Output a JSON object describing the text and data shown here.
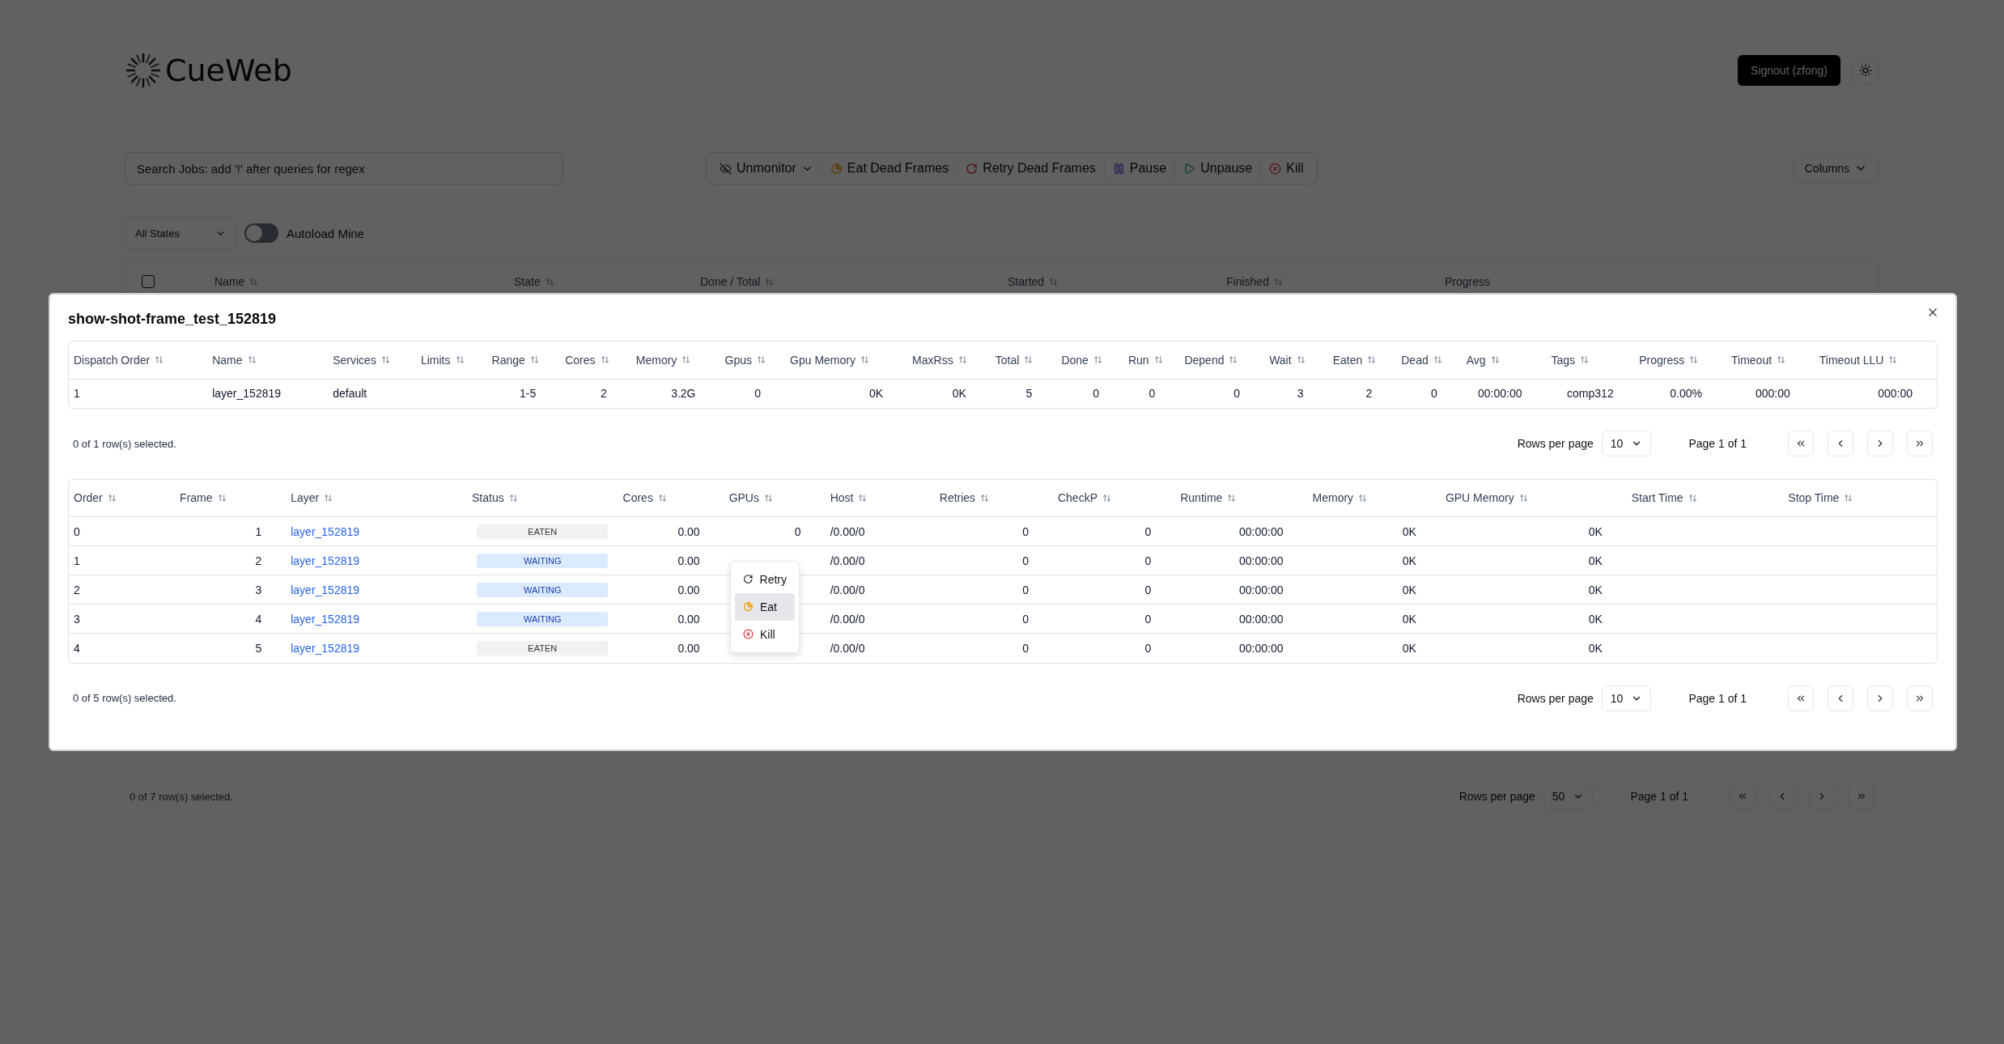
{
  "header": {
    "logo": "CueWeb",
    "signout": "Signout (zfong)"
  },
  "search": {
    "placeholder": "Search Jobs: add '!' after queries for regex"
  },
  "toolbar": [
    {
      "label": "Unmonitor",
      "kind": "unmonitor"
    },
    {
      "label": "Eat Dead Frames",
      "kind": "eat"
    },
    {
      "label": "Retry Dead Frames",
      "kind": "retry"
    },
    {
      "label": "Pause",
      "kind": "pause"
    },
    {
      "label": "Unpause",
      "kind": "unpause"
    },
    {
      "label": "Kill",
      "kind": "kill"
    }
  ],
  "columns_button": "Columns",
  "filters": {
    "state": "All States",
    "autoload": {
      "label": "Autoload Mine",
      "on": false
    }
  },
  "jobs_table": {
    "checked": false,
    "columns": [
      "Name",
      "State",
      "Done / Total",
      "Started",
      "Finished",
      "Progress"
    ]
  },
  "jobs_footer": {
    "selected_text": "0 of 7 row(s) selected.",
    "rows_per_page_label": "Rows per page",
    "rows_per_page": "50",
    "page": "Page 1 of 1"
  },
  "dialog": {
    "title": "show-shot-frame_test_152819",
    "layers_table": {
      "columns": [
        "Dispatch Order",
        "Name",
        "Services",
        "Limits",
        "Range",
        "Cores",
        "Memory",
        "Gpus",
        "Gpu Memory",
        "MaxRss",
        "Total",
        "Done",
        "Run",
        "Depend",
        "Wait",
        "Eaten",
        "Dead",
        "Avg",
        "Tags",
        "Progress",
        "Timeout",
        "Timeout LLU"
      ],
      "rows": [
        [
          "1",
          "layer_152819",
          "default",
          null,
          "1-5",
          "2",
          "3.2G",
          "0",
          "0K",
          "0K",
          "5",
          "0",
          "0",
          "0",
          "3",
          "2",
          "0",
          "00:00:00",
          "comp312",
          "0.00%",
          "000:00",
          "000:00"
        ]
      ]
    },
    "layers_footer": {
      "selected_text": "0 of 1 row(s) selected.",
      "rows_per_page_label": "Rows per page",
      "rows_per_page": "10",
      "page": "Page 1 of 1"
    },
    "frames_table": {
      "columns": [
        "Order",
        "Frame",
        "Layer",
        "Status",
        "Cores",
        "GPUs",
        "Host",
        "Retries",
        "CheckP",
        "Runtime",
        "Memory",
        "GPU Memory",
        "Start Time",
        "Stop Time"
      ],
      "rows": [
        {
          "color": "#f1f1f3",
          "cells": [
            "0",
            "1",
            "layer_152819",
            "EATEN",
            "0.00",
            "0",
            "/0.00/0",
            "0",
            "0",
            "00:00:00",
            "0K",
            "0K"
          ]
        },
        {
          "color": "#dbeafe",
          "cells": [
            "1",
            "2",
            "layer_152819",
            "WAITING",
            "0.00",
            null,
            "/0.00/0",
            "0",
            "0",
            "00:00:00",
            "0K",
            "0K"
          ]
        },
        {
          "color": "#dbeafe",
          "cells": [
            "2",
            "3",
            "layer_152819",
            "WAITING",
            "0.00",
            null,
            "/0.00/0",
            "0",
            "0",
            "00:00:00",
            "0K",
            "0K"
          ]
        },
        {
          "color": "#dbeafe",
          "cells": [
            "3",
            "4",
            "layer_152819",
            "WAITING",
            "0.00",
            null,
            "/0.00/0",
            "0",
            "0",
            "00:00:00",
            "0K",
            "0K"
          ]
        },
        {
          "color": "#f1f1f3",
          "cells": [
            "4",
            "5",
            "layer_152819",
            "EATEN",
            "0.00",
            null,
            "/0.00/0",
            "0",
            "0",
            "00:00:00",
            "0K",
            "0K"
          ]
        }
      ]
    },
    "frames_footer": {
      "selected_text": "0 of 5 row(s) selected.",
      "rows_per_page_label": "Rows per page",
      "rows_per_page": "10",
      "page": "Page 1 of 1"
    },
    "context_menu": [
      {
        "label": "Retry",
        "kind": "retry",
        "selected": false
      },
      {
        "label": "Eat",
        "kind": "eat",
        "selected": true
      },
      {
        "label": "Kill",
        "kind": "kill",
        "selected": false
      }
    ]
  }
}
